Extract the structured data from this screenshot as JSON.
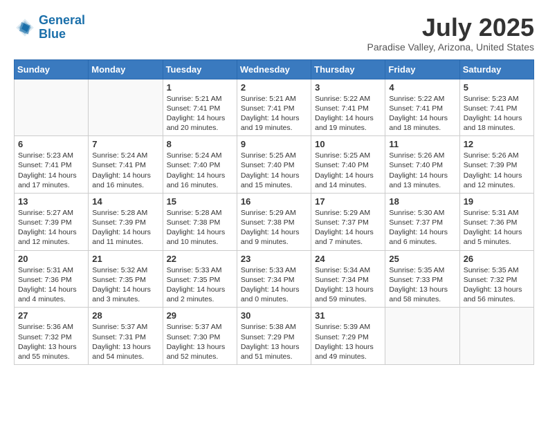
{
  "header": {
    "logo_line1": "General",
    "logo_line2": "Blue",
    "month": "July 2025",
    "location": "Paradise Valley, Arizona, United States"
  },
  "days_of_week": [
    "Sunday",
    "Monday",
    "Tuesday",
    "Wednesday",
    "Thursday",
    "Friday",
    "Saturday"
  ],
  "weeks": [
    [
      {
        "day": "",
        "info": ""
      },
      {
        "day": "",
        "info": ""
      },
      {
        "day": "1",
        "info": "Sunrise: 5:21 AM\nSunset: 7:41 PM\nDaylight: 14 hours and 20 minutes."
      },
      {
        "day": "2",
        "info": "Sunrise: 5:21 AM\nSunset: 7:41 PM\nDaylight: 14 hours and 19 minutes."
      },
      {
        "day": "3",
        "info": "Sunrise: 5:22 AM\nSunset: 7:41 PM\nDaylight: 14 hours and 19 minutes."
      },
      {
        "day": "4",
        "info": "Sunrise: 5:22 AM\nSunset: 7:41 PM\nDaylight: 14 hours and 18 minutes."
      },
      {
        "day": "5",
        "info": "Sunrise: 5:23 AM\nSunset: 7:41 PM\nDaylight: 14 hours and 18 minutes."
      }
    ],
    [
      {
        "day": "6",
        "info": "Sunrise: 5:23 AM\nSunset: 7:41 PM\nDaylight: 14 hours and 17 minutes."
      },
      {
        "day": "7",
        "info": "Sunrise: 5:24 AM\nSunset: 7:41 PM\nDaylight: 14 hours and 16 minutes."
      },
      {
        "day": "8",
        "info": "Sunrise: 5:24 AM\nSunset: 7:40 PM\nDaylight: 14 hours and 16 minutes."
      },
      {
        "day": "9",
        "info": "Sunrise: 5:25 AM\nSunset: 7:40 PM\nDaylight: 14 hours and 15 minutes."
      },
      {
        "day": "10",
        "info": "Sunrise: 5:25 AM\nSunset: 7:40 PM\nDaylight: 14 hours and 14 minutes."
      },
      {
        "day": "11",
        "info": "Sunrise: 5:26 AM\nSunset: 7:40 PM\nDaylight: 14 hours and 13 minutes."
      },
      {
        "day": "12",
        "info": "Sunrise: 5:26 AM\nSunset: 7:39 PM\nDaylight: 14 hours and 12 minutes."
      }
    ],
    [
      {
        "day": "13",
        "info": "Sunrise: 5:27 AM\nSunset: 7:39 PM\nDaylight: 14 hours and 12 minutes."
      },
      {
        "day": "14",
        "info": "Sunrise: 5:28 AM\nSunset: 7:39 PM\nDaylight: 14 hours and 11 minutes."
      },
      {
        "day": "15",
        "info": "Sunrise: 5:28 AM\nSunset: 7:38 PM\nDaylight: 14 hours and 10 minutes."
      },
      {
        "day": "16",
        "info": "Sunrise: 5:29 AM\nSunset: 7:38 PM\nDaylight: 14 hours and 9 minutes."
      },
      {
        "day": "17",
        "info": "Sunrise: 5:29 AM\nSunset: 7:37 PM\nDaylight: 14 hours and 7 minutes."
      },
      {
        "day": "18",
        "info": "Sunrise: 5:30 AM\nSunset: 7:37 PM\nDaylight: 14 hours and 6 minutes."
      },
      {
        "day": "19",
        "info": "Sunrise: 5:31 AM\nSunset: 7:36 PM\nDaylight: 14 hours and 5 minutes."
      }
    ],
    [
      {
        "day": "20",
        "info": "Sunrise: 5:31 AM\nSunset: 7:36 PM\nDaylight: 14 hours and 4 minutes."
      },
      {
        "day": "21",
        "info": "Sunrise: 5:32 AM\nSunset: 7:35 PM\nDaylight: 14 hours and 3 minutes."
      },
      {
        "day": "22",
        "info": "Sunrise: 5:33 AM\nSunset: 7:35 PM\nDaylight: 14 hours and 2 minutes."
      },
      {
        "day": "23",
        "info": "Sunrise: 5:33 AM\nSunset: 7:34 PM\nDaylight: 14 hours and 0 minutes."
      },
      {
        "day": "24",
        "info": "Sunrise: 5:34 AM\nSunset: 7:34 PM\nDaylight: 13 hours and 59 minutes."
      },
      {
        "day": "25",
        "info": "Sunrise: 5:35 AM\nSunset: 7:33 PM\nDaylight: 13 hours and 58 minutes."
      },
      {
        "day": "26",
        "info": "Sunrise: 5:35 AM\nSunset: 7:32 PM\nDaylight: 13 hours and 56 minutes."
      }
    ],
    [
      {
        "day": "27",
        "info": "Sunrise: 5:36 AM\nSunset: 7:32 PM\nDaylight: 13 hours and 55 minutes."
      },
      {
        "day": "28",
        "info": "Sunrise: 5:37 AM\nSunset: 7:31 PM\nDaylight: 13 hours and 54 minutes."
      },
      {
        "day": "29",
        "info": "Sunrise: 5:37 AM\nSunset: 7:30 PM\nDaylight: 13 hours and 52 minutes."
      },
      {
        "day": "30",
        "info": "Sunrise: 5:38 AM\nSunset: 7:29 PM\nDaylight: 13 hours and 51 minutes."
      },
      {
        "day": "31",
        "info": "Sunrise: 5:39 AM\nSunset: 7:29 PM\nDaylight: 13 hours and 49 minutes."
      },
      {
        "day": "",
        "info": ""
      },
      {
        "day": "",
        "info": ""
      }
    ]
  ]
}
